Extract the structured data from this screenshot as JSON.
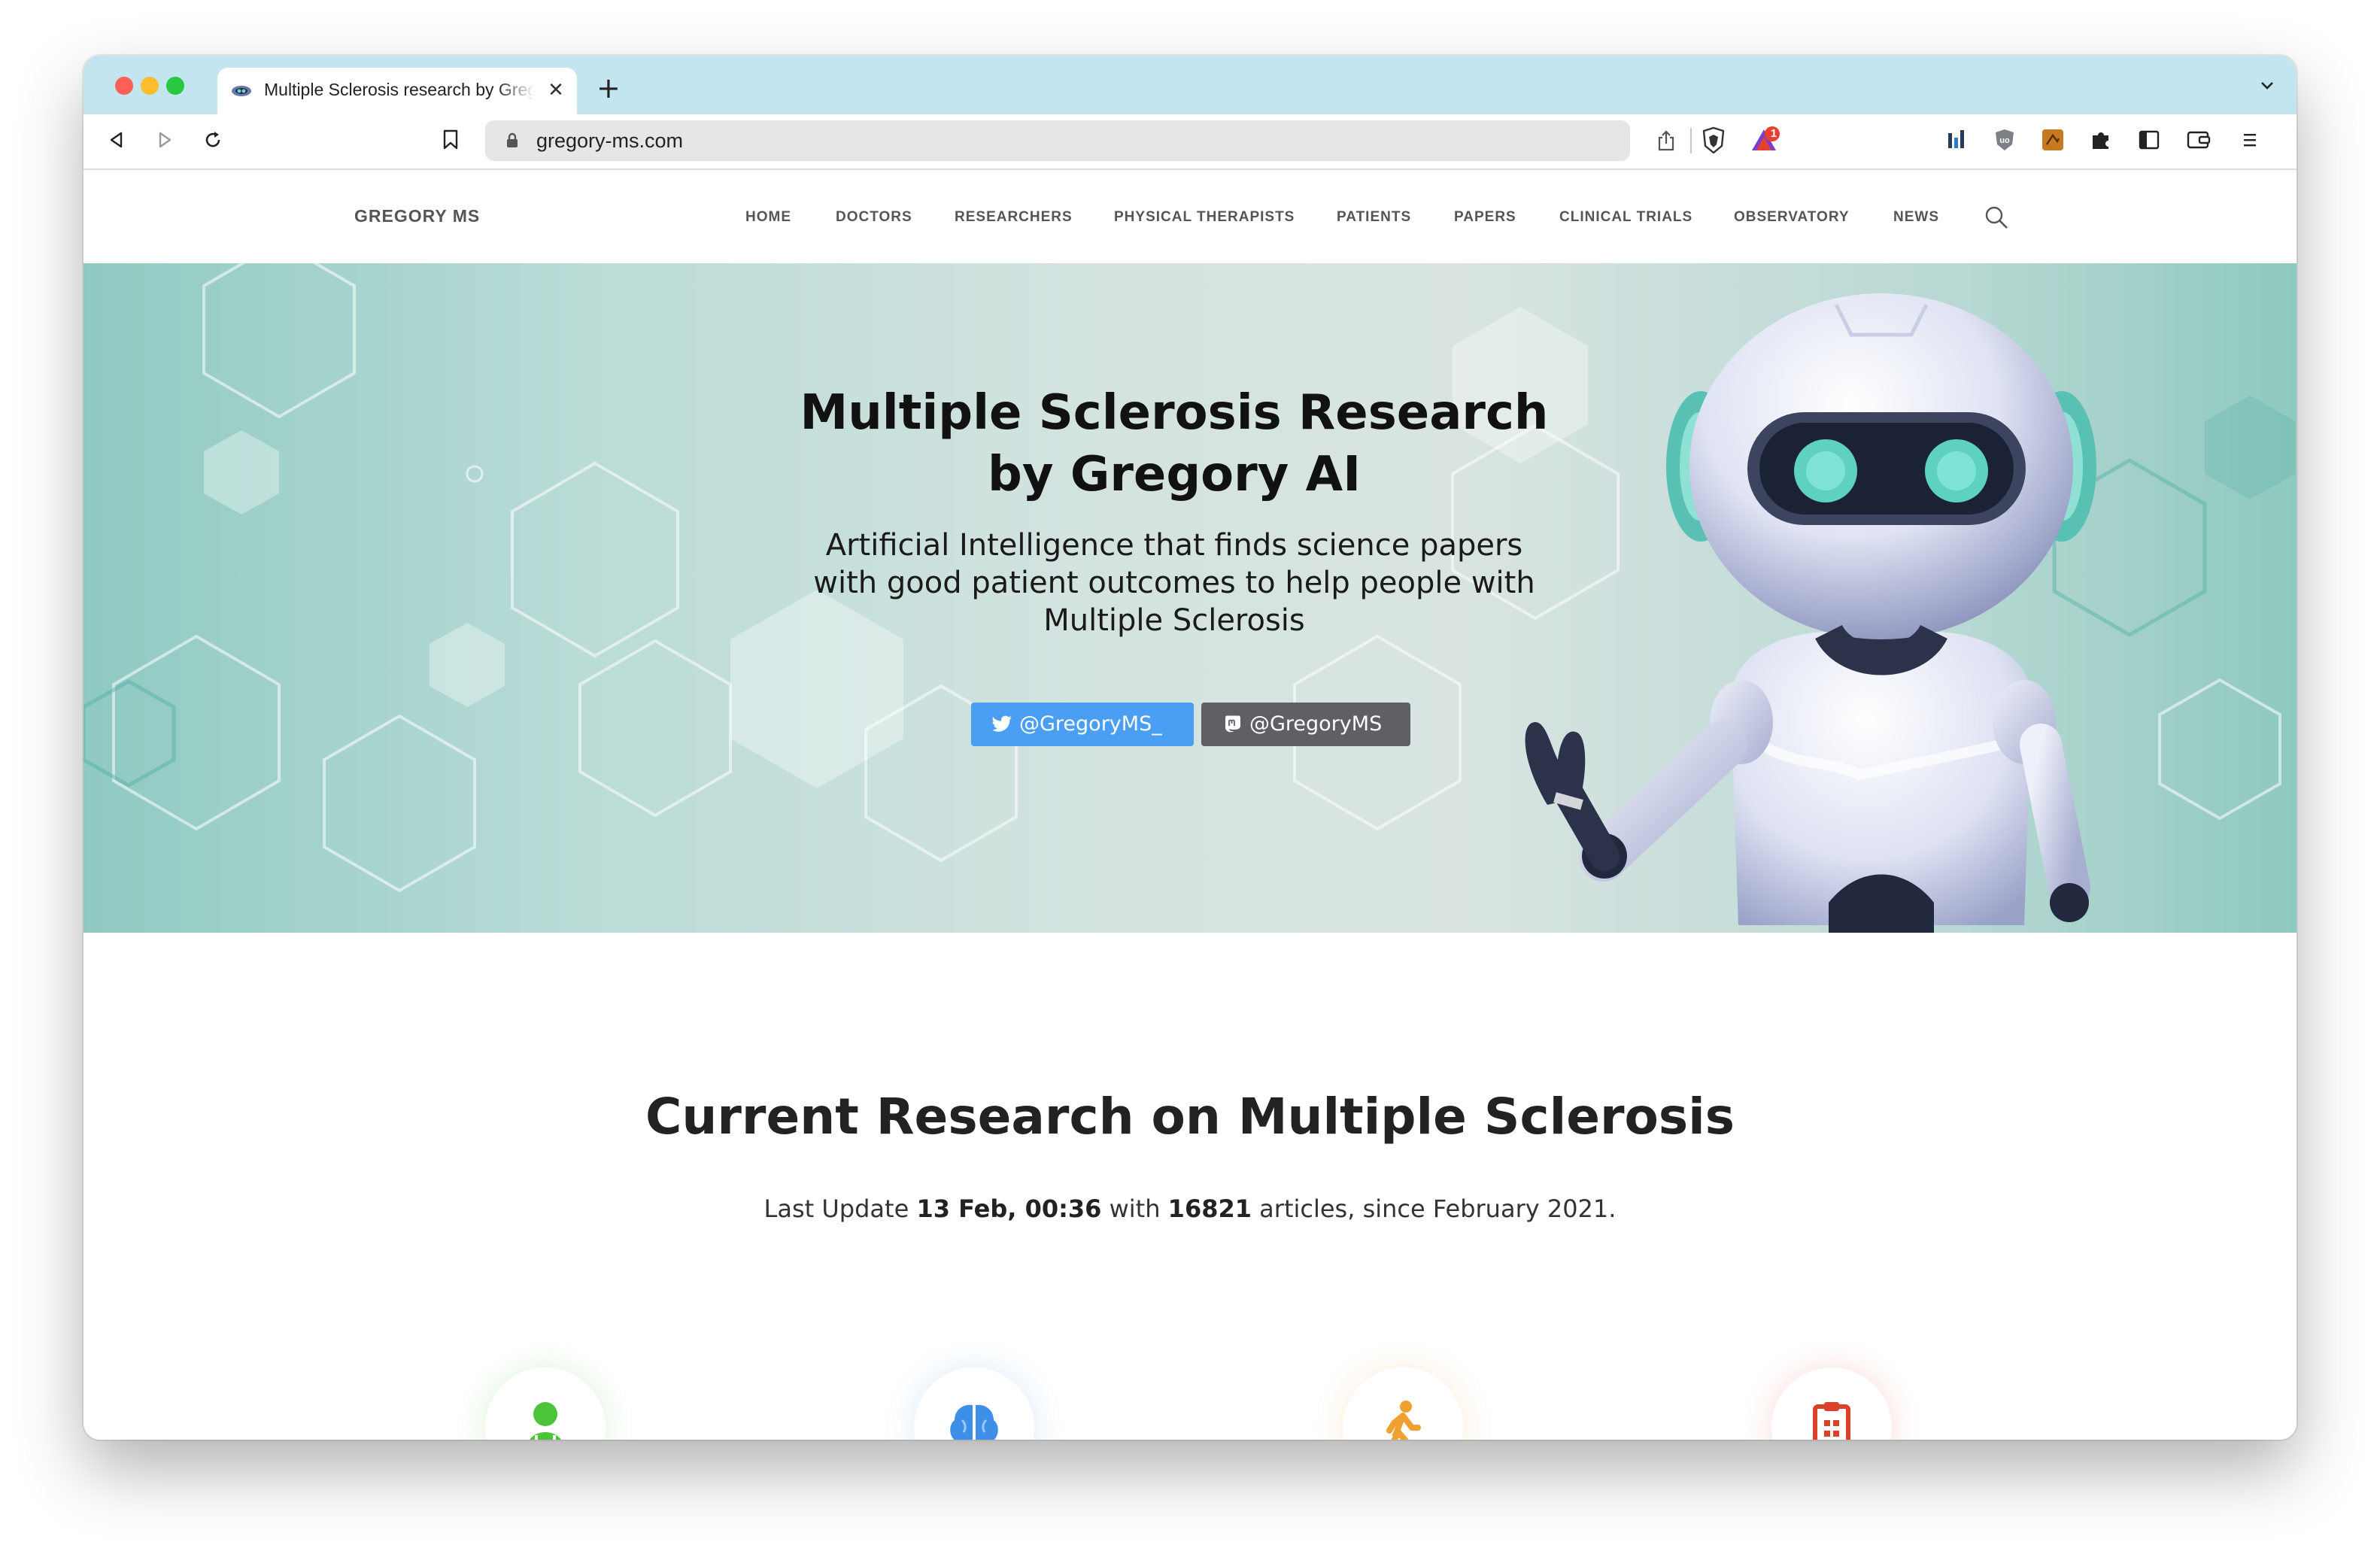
{
  "browser": {
    "tab_title": "Multiple Sclerosis research by Gregory AI",
    "tab_close": "✕",
    "new_tab": "+",
    "url": "gregory-ms.com",
    "shields_badge": "1",
    "traffic_colors": [
      "#ff5f57",
      "#febc2e",
      "#28c840"
    ]
  },
  "site": {
    "brand": "GREGORY MS",
    "nav": [
      "HOME",
      "DOCTORS",
      "RESEARCHERS",
      "PHYSICAL THERAPISTS",
      "PATIENTS",
      "PAPERS",
      "CLINICAL TRIALS",
      "OBSERVATORY",
      "NEWS"
    ]
  },
  "hero": {
    "title_line1": "Multiple Sclerosis Research",
    "title_line2": "by Gregory AI",
    "subtitle_line1": "Artificial Intelligence that finds science papers",
    "subtitle_line2": "with good patient outcomes to help people with",
    "subtitle_line3": "Multiple Sclerosis",
    "twitter_label": "@GregoryMS_",
    "mastodon_label": "@GregoryMS",
    "twitter_color": "#4a9ff3",
    "mastodon_color": "#5e6066"
  },
  "research": {
    "heading": "Current Research on Multiple Sclerosis",
    "update_prefix": "Last Update ",
    "update_date": "13 Feb, 00:36",
    "update_mid": " with ",
    "article_count": "16821",
    "update_suffix": " articles, since February 2021."
  },
  "features": [
    {
      "icon": "doctor-icon",
      "color": "#4cc43a"
    },
    {
      "icon": "brain-icon",
      "color": "#3d8fe8"
    },
    {
      "icon": "walking-person-icon",
      "color": "#f0a030"
    },
    {
      "icon": "clipboard-icon",
      "color": "#d9412b"
    }
  ]
}
